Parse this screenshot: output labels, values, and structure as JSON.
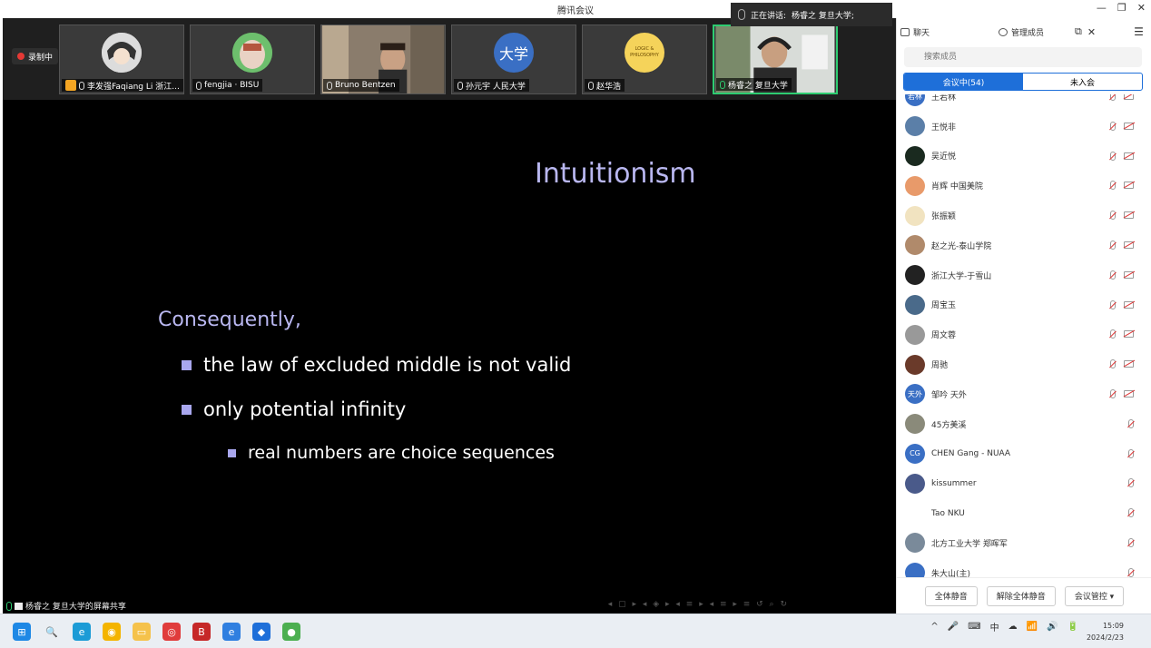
{
  "window": {
    "title": "腾讯会议",
    "speaking_prefix": "正在讲话:",
    "speaking_name": "杨睿之 复旦大学;",
    "controls": [
      "—",
      "❐",
      "✕"
    ]
  },
  "recording": {
    "label": "录制中"
  },
  "tiles": [
    {
      "name": "李发强Faqiang Li 浙江...",
      "kind": "avatar-anime",
      "host": true
    },
    {
      "name": "fengjia · BISU",
      "kind": "avatar-round"
    },
    {
      "name": "Bruno Bentzen",
      "kind": "video"
    },
    {
      "name": "孙元宇 人民大学",
      "kind": "text-avatar",
      "avatar_text": "大学",
      "color": "#3a6fc4"
    },
    {
      "name": "赵华浩",
      "kind": "logo",
      "logo_text": "LOGIC & PHILOSOPHY"
    },
    {
      "name": "杨睿之 复旦大学",
      "kind": "video2",
      "active": true
    }
  ],
  "slide": {
    "title": "Intuitionism",
    "lead": "Consequently,",
    "bullets": [
      "the law of excluded middle is not valid",
      "only potential infinity"
    ],
    "sub_bullets": [
      "real numbers are choice sequences"
    ]
  },
  "share_label": "杨睿之 复旦大学的屏幕共享",
  "beamer_nav": "◂ ▢ ▸ ◂ ◈ ▸ ◂ ≡ ▸ ◂ ≡ ▸  ≡  ↺ ⌕ ↻",
  "panel": {
    "tabs": {
      "chat": "聊天",
      "members": "管理成员"
    },
    "search_placeholder": "搜索成员",
    "segment_in": "会议中(54)",
    "segment_out": "未入会",
    "members": [
      {
        "name": "王若林",
        "avatar_text": "若林",
        "color": "#3a6fc4",
        "cam": true
      },
      {
        "name": "王悦非",
        "color": "#5b7fa8",
        "cam": true
      },
      {
        "name": "吴近悦",
        "color": "#1a2a1f",
        "cam": true
      },
      {
        "name": "肖辉 中国美院",
        "color": "#e89a6a",
        "cam": true
      },
      {
        "name": "张振颖",
        "color": "#f1e3c0",
        "cam": true
      },
      {
        "name": "赵之光-泰山学院",
        "color": "#b08a6b",
        "cam": true
      },
      {
        "name": "浙江大学-于雪山",
        "color": "#222222",
        "cam": true
      },
      {
        "name": "周宝玉",
        "color": "#4a6a8a",
        "cam": true
      },
      {
        "name": "周文蓉",
        "color": "#999999",
        "cam": true
      },
      {
        "name": "周驰",
        "color": "#6a3a2a",
        "cam": true
      },
      {
        "name": "邹吟 天外",
        "avatar_text": "天外",
        "color": "#3a6fc4",
        "cam": true
      },
      {
        "name": "45方美溪",
        "color": "#8a8a7a",
        "cam": false
      },
      {
        "name": "CHEN Gang - NUAA",
        "avatar_text": "CG",
        "color": "#3a6fc4",
        "cam": false
      },
      {
        "name": "kissummer",
        "color": "#4a5a8a",
        "cam": false
      },
      {
        "name": "Tao NKU",
        "color": "#ffffff",
        "cam": false
      },
      {
        "name": "北方工业大学 郑晖军",
        "color": "#7a8a9a",
        "cam": false
      },
      {
        "name": "朱大山(主)",
        "color": "#3a6fc4",
        "cam": false
      }
    ],
    "footer": {
      "mute_all": "全体静音",
      "unmute_all": "解除全体静音",
      "control": "会议管控 ▾"
    }
  },
  "taskbar": {
    "apps": [
      {
        "name": "start",
        "color": "#1e88e5",
        "glyph": "⊞"
      },
      {
        "name": "search",
        "color": "#eaeef3",
        "glyph": "🔍"
      },
      {
        "name": "edge",
        "color": "#1c9bd6",
        "glyph": "e"
      },
      {
        "name": "chrome",
        "color": "#f4b400",
        "glyph": "◉"
      },
      {
        "name": "explorer",
        "color": "#f5c24b",
        "glyph": "▭"
      },
      {
        "name": "netease",
        "color": "#e03c3c",
        "glyph": "◎"
      },
      {
        "name": "app-b",
        "color": "#c62828",
        "glyph": "B"
      },
      {
        "name": "browser",
        "color": "#2f7fe0",
        "glyph": "e"
      },
      {
        "name": "tencent-meeting",
        "color": "#1e6fd9",
        "glyph": "◆"
      },
      {
        "name": "wechat",
        "color": "#4caf50",
        "glyph": "●"
      }
    ],
    "tray": [
      "^",
      "🎤",
      "⌨",
      "中",
      "☁",
      "📶",
      "🔊",
      "🔋"
    ],
    "time": "15:09",
    "date": "2024/2/23"
  }
}
